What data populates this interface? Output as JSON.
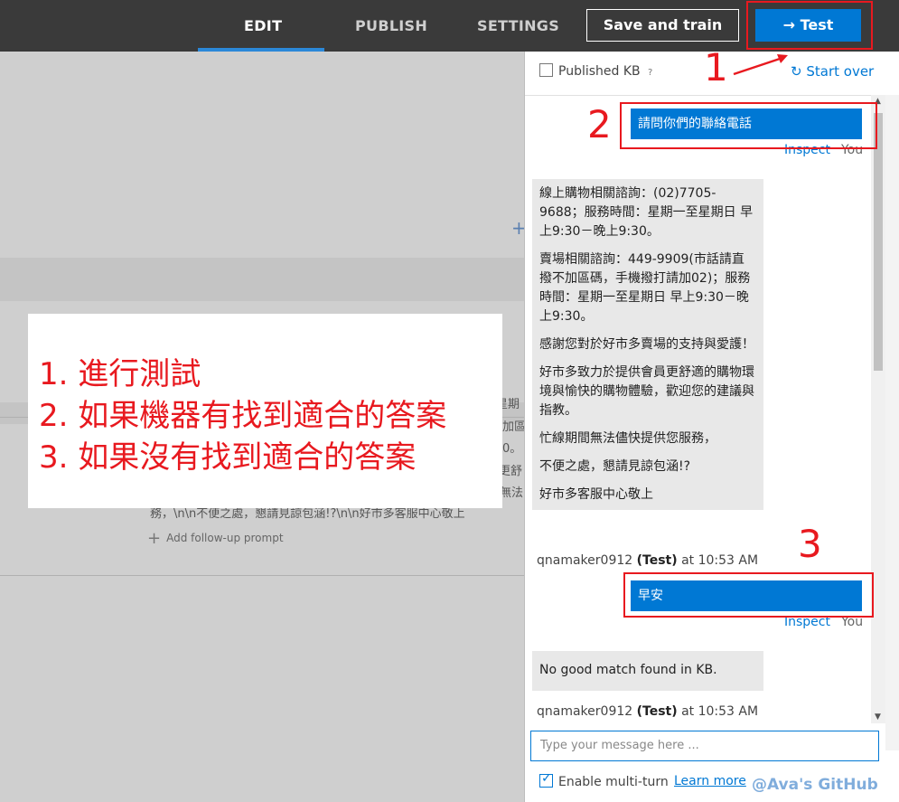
{
  "nav": {
    "tabs": [
      {
        "label": "EDIT",
        "active": true
      },
      {
        "label": "PUBLISH",
        "active": false
      },
      {
        "label": "SETTINGS",
        "active": false
      }
    ],
    "save_label": "Save and train",
    "test_label": "→ Test"
  },
  "background_fragments": {
    "line1": "至星期",
    "line2": "加區",
    "line3": "0。",
    "line4": "更舒",
    "line5": "無法",
    "line6": "務，\\n\\n不便之處，懇請見諒包涵!?\\n\\n好市多客服中心敬上",
    "followup": "Add follow-up prompt"
  },
  "annotation": {
    "line1": "1. 進行測試",
    "line2": "2. 如果機器有找到適合的答案",
    "line3": "3. 如果沒有找到適合的答案"
  },
  "markers": {
    "one": "1",
    "two": "2",
    "three": "3"
  },
  "chat": {
    "published_label": "Published KB",
    "help": "?",
    "start_over": "Start over",
    "messages": {
      "user1": "請問你們的聯絡電話",
      "inspect": "Inspect",
      "you": "You",
      "bot1": [
        "線上購物相關諮詢：(02)7705-9688；服務時間：星期一至星期日 早上9:30－晚上9:30。",
        "賣場相關諮詢：449-9909(市話請直撥不加區碼，手機撥打請加02)；服務時間：星期一至星期日 早上9:30－晚上9:30。",
        "感謝您對於好市多賣場的支持與愛護！",
        "好市多致力於提供會員更舒適的購物環境與愉快的購物體驗，歡迎您的建議與指教。",
        "忙線期間無法儘快提供您服務，",
        "不便之處，懇請見諒包涵!?",
        "好市多客服中心敬上"
      ],
      "sender_name": "qnamaker0912",
      "sender_tag": "(Test)",
      "sender_time": "at 10:53 AM",
      "user2": "早安",
      "bot2": "No good match found in KB."
    },
    "input_placeholder": "Type your message here ...",
    "multiturn_label": "Enable multi-turn",
    "learn_more": "Learn more"
  },
  "watermark": "@Ava's GitHub"
}
